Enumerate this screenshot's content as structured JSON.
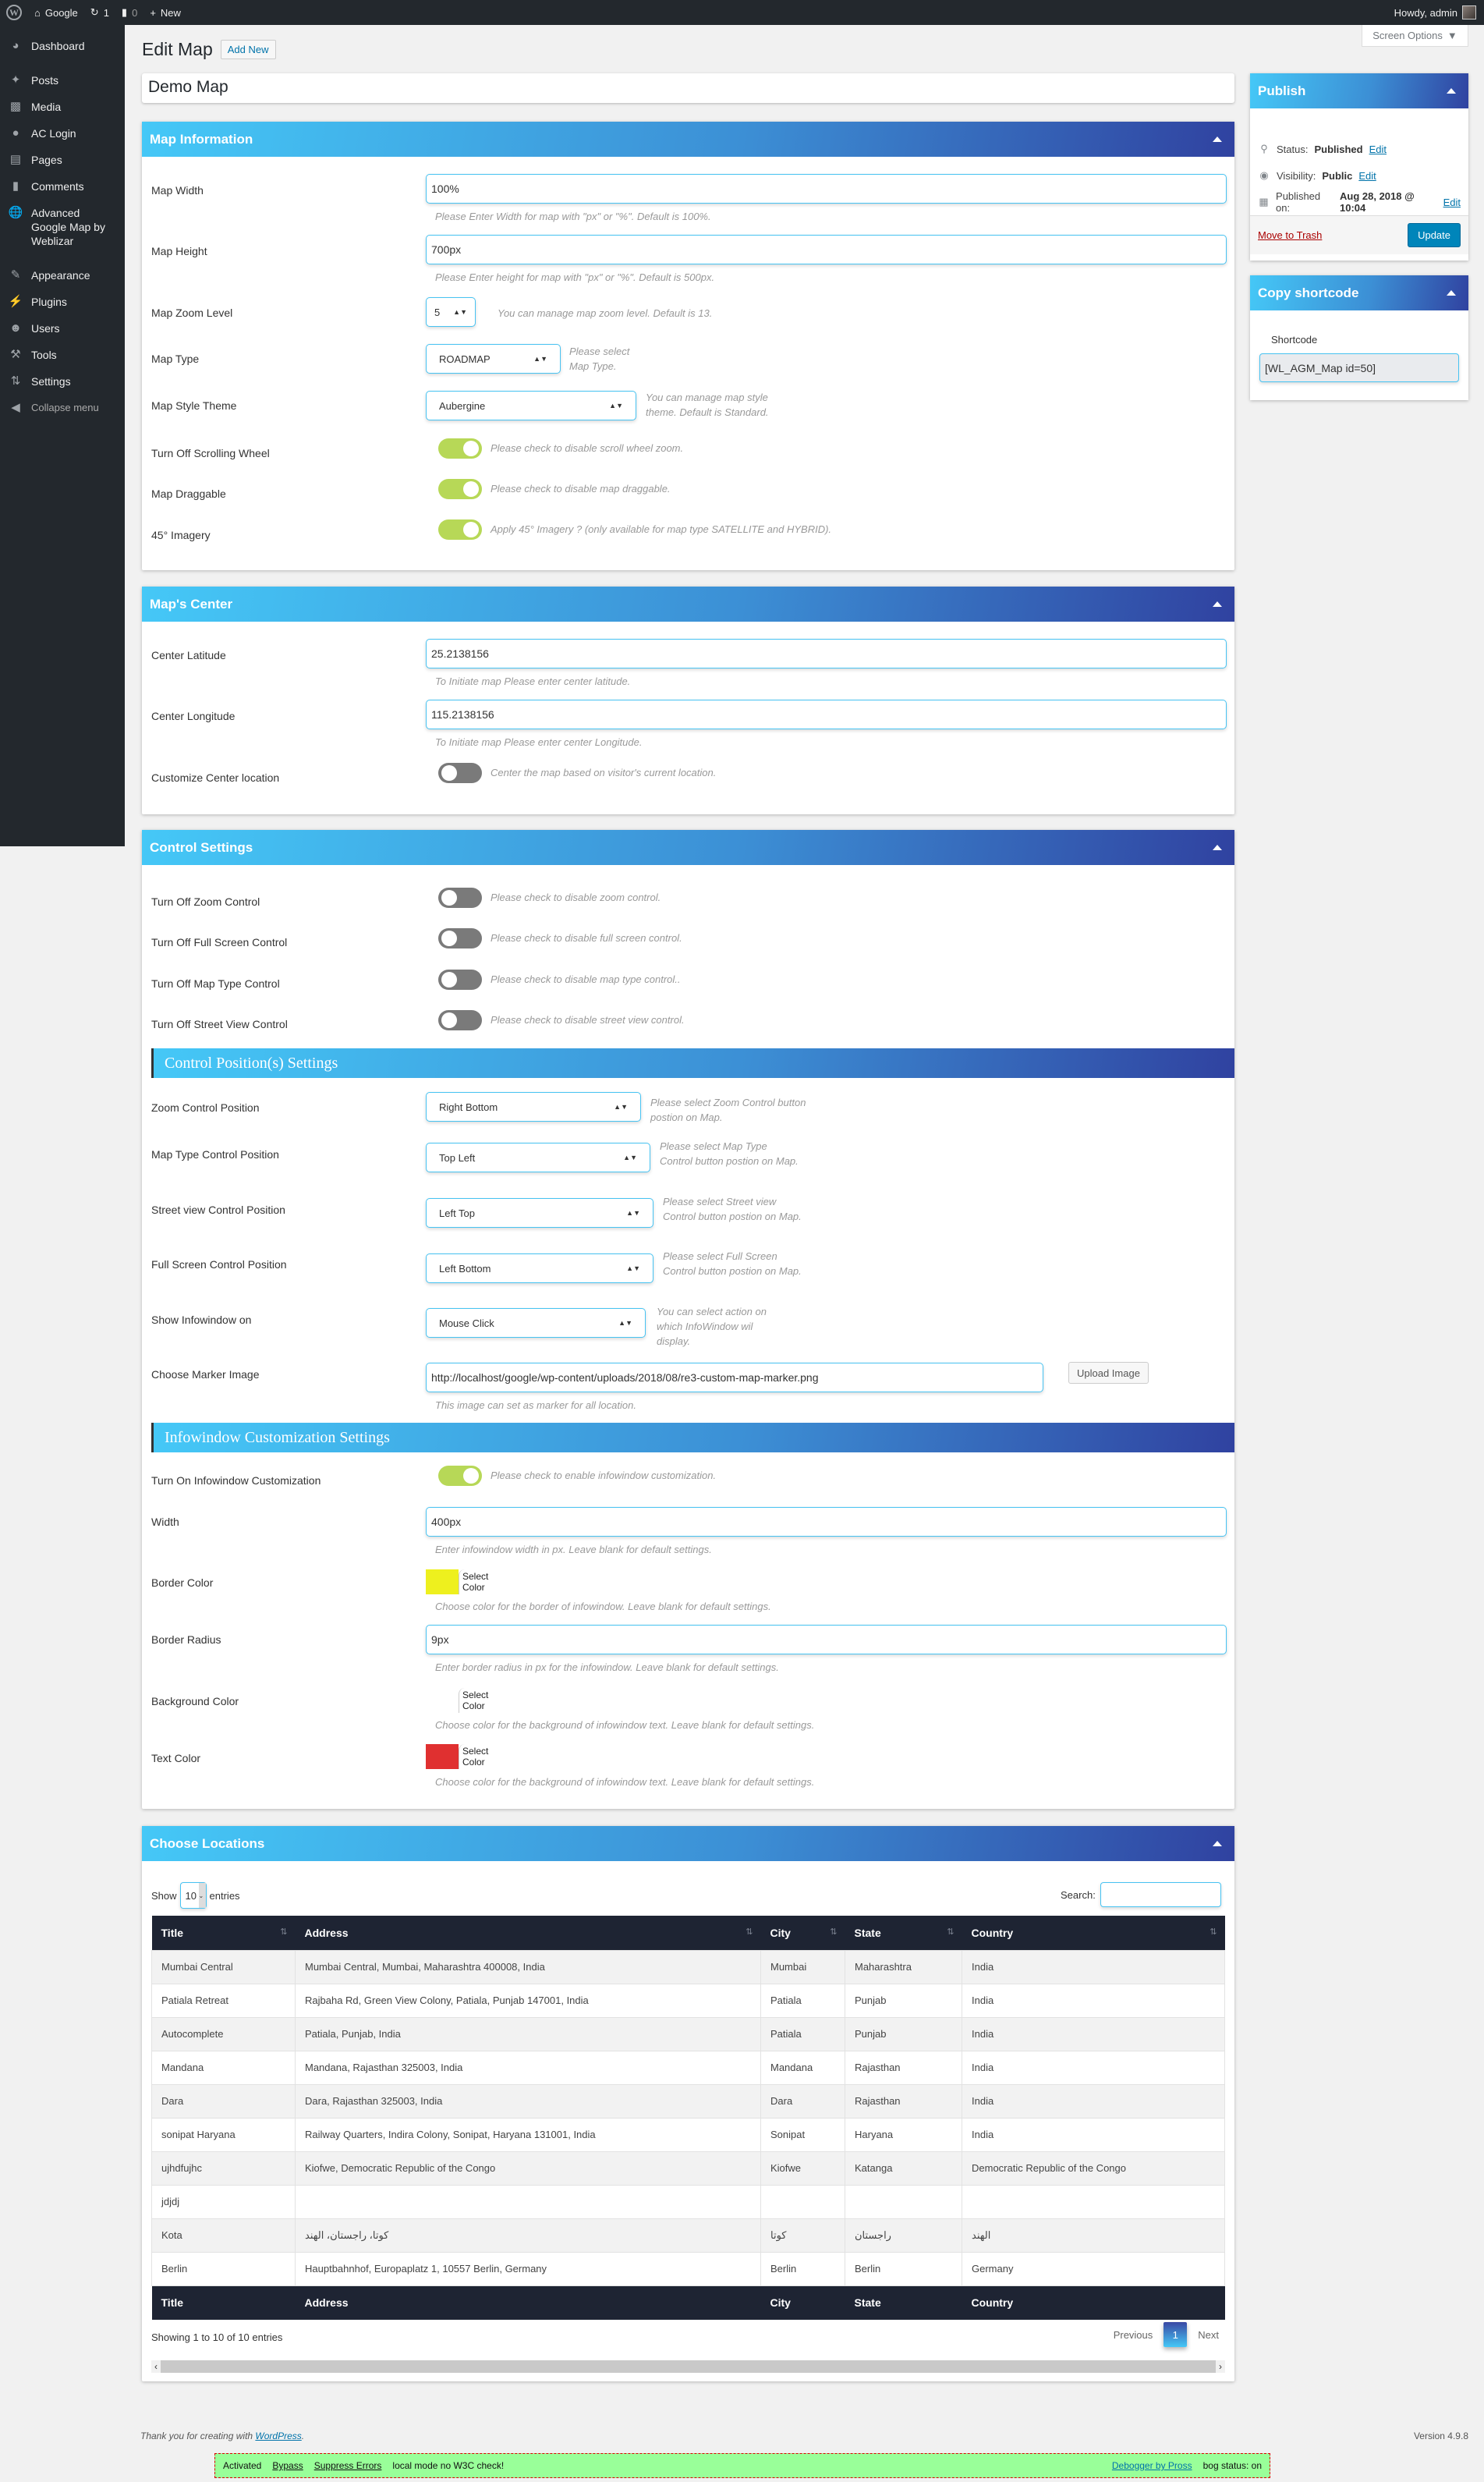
{
  "adminbar": {
    "site_name": "Google",
    "updates_count": "1",
    "comments_count": "0",
    "new_label": "New",
    "howdy": "Howdy, admin"
  },
  "sidebar": {
    "items": [
      {
        "label": "Dashboard",
        "icon": "dashboard-icon"
      },
      {
        "label": "Posts",
        "icon": "pin-icon"
      },
      {
        "label": "Media",
        "icon": "media-icon"
      },
      {
        "label": "AC Login",
        "icon": "login-icon"
      },
      {
        "label": "Pages",
        "icon": "pages-icon"
      },
      {
        "label": "Comments",
        "icon": "comment-icon"
      },
      {
        "label": "Advanced Google Map by Weblizar",
        "icon": "globe-icon"
      },
      {
        "label": "Appearance",
        "icon": "brush-icon"
      },
      {
        "label": "Plugins",
        "icon": "plug-icon"
      },
      {
        "label": "Users",
        "icon": "user-icon"
      },
      {
        "label": "Tools",
        "icon": "wrench-icon"
      },
      {
        "label": "Settings",
        "icon": "settings-icon"
      },
      {
        "label": "Collapse menu",
        "icon": "collapse-icon"
      }
    ]
  },
  "header": {
    "screen_options": "Screen Options",
    "page_title": "Edit Map",
    "add_new": "Add New",
    "post_title": "Demo Map"
  },
  "map_info": {
    "title": "Map Information",
    "width_label": "Map Width",
    "width_value": "100%",
    "width_help": "Please Enter Width for map with \"px\" or \"%\". Default is 100%.",
    "height_label": "Map Height",
    "height_value": "700px",
    "height_help": "Please Enter height for map with \"px\" or \"%\". Default is 500px.",
    "zoom_label": "Map Zoom Level",
    "zoom_value": "5",
    "zoom_help": "You can manage map zoom level. Default is 13.",
    "type_label": "Map Type",
    "type_value": "ROADMAP",
    "type_help": "Please select Map Type.",
    "style_label": "Map Style Theme",
    "style_value": "Aubergine",
    "style_help": "You can manage map style theme. Default is Standard.",
    "scroll_label": "Turn Off Scrolling Wheel",
    "scroll_on": true,
    "scroll_help": "Please check to disable scroll wheel zoom.",
    "drag_label": "Map Draggable",
    "drag_on": true,
    "drag_help": "Please check to disable map draggable.",
    "imagery_label": "45° Imagery",
    "imagery_on": true,
    "imagery_help": "Apply 45° Imagery ? (only available for map type SATELLITE and HYBRID)."
  },
  "map_center": {
    "title": "Map's Center",
    "lat_label": "Center Latitude",
    "lat_value": "25.2138156",
    "lat_help": "To Initiate map Please enter center latitude.",
    "lng_label": "Center Longitude",
    "lng_value": "115.2138156",
    "lng_help": "To Initiate map Please enter center Longitude.",
    "custom_label": "Customize Center location",
    "custom_on": false,
    "custom_help": "Center the map based on visitor's current location."
  },
  "control": {
    "title": "Control Settings",
    "zoom_ctrl_label": "Turn Off Zoom Control",
    "zoom_ctrl_help": "Please check to disable zoom control.",
    "fullscreen_label": "Turn Off Full Screen Control",
    "fullscreen_help": "Please check to disable full screen control.",
    "maptype_label": "Turn Off Map Type Control",
    "maptype_help": "Please check to disable map type control..",
    "street_label": "Turn Off Street View Control",
    "street_help": "Please check to disable street view control.",
    "positions_title": "Control Position(s) Settings",
    "zoom_pos_label": "Zoom Control Position",
    "zoom_pos_value": "Right Bottom",
    "zoom_pos_help": "Please select Zoom Control button postion on Map.",
    "maptype_pos_label": "Map Type Control Position",
    "maptype_pos_value": "Top Left",
    "maptype_pos_help": "Please select Map Type Control button postion on Map.",
    "street_pos_label": "Street view Control Position",
    "street_pos_value": "Left Top",
    "street_pos_help": "Please select Street view Control button postion on Map.",
    "fs_pos_label": "Full Screen Control Position",
    "fs_pos_value": "Left Bottom",
    "fs_pos_help": "Please select Full Screen Control button postion on Map.",
    "infowin_label": "Show Infowindow on",
    "infowin_value": "Mouse Click",
    "infowin_help": "You can select action on which InfoWindow wil display.",
    "marker_label": "Choose Marker Image",
    "marker_value": "http://localhost/google/wp-content/uploads/2018/08/re3-custom-map-marker.png",
    "marker_help": "This image can set as marker for all location.",
    "upload_label": "Upload Image",
    "infowin_title": "Infowindow Customization Settings",
    "iw_on_label": "Turn On Infowindow Customization",
    "iw_on_help": "Please check to enable infowindow customization.",
    "iw_width_label": "Width",
    "iw_width_value": "400px",
    "iw_width_help": "Enter infowindow width in px. Leave blank for default settings.",
    "border_color_label": "Border Color",
    "border_color": "#eef01e",
    "border_color_help": "Choose color for the border of infowindow. Leave blank for default settings.",
    "radius_label": "Border Radius",
    "radius_value": "9px",
    "radius_help": "Enter border radius in px for the infowindow. Leave blank for default settings.",
    "bg_color_label": "Background Color",
    "bg_color": "#ffffff",
    "bg_color_help": "Choose color for the background of infowindow text. Leave blank for default settings.",
    "text_color_label": "Text Color",
    "text_color": "#e03030",
    "text_color_help": "Choose color for the background of infowindow text. Leave blank for default settings.",
    "select_color": "Select Color"
  },
  "locations": {
    "title": "Choose Locations",
    "show": "Show",
    "entries_value": "10",
    "entries": "entries",
    "search_label": "Search:",
    "search_value": "",
    "columns": [
      "Title",
      "Address",
      "City",
      "State",
      "Country"
    ],
    "rows": [
      [
        "Mumbai Central",
        "Mumbai Central, Mumbai, Maharashtra 400008, India",
        "Mumbai",
        "Maharashtra",
        "India"
      ],
      [
        "Patiala Retreat",
        "Rajbaha Rd, Green View Colony, Patiala, Punjab 147001, India",
        "Patiala",
        "Punjab",
        "India"
      ],
      [
        "Autocomplete",
        "Patiala, Punjab, India",
        "Patiala",
        "Punjab",
        "India"
      ],
      [
        "Mandana",
        "Mandana, Rajasthan 325003, India",
        "Mandana",
        "Rajasthan",
        "India"
      ],
      [
        "Dara",
        "Dara, Rajasthan 325003, India",
        "Dara",
        "Rajasthan",
        "India"
      ],
      [
        "sonipat Haryana",
        "Railway Quarters, Indira Colony, Sonipat, Haryana 131001, India",
        "Sonipat",
        "Haryana",
        "India"
      ],
      [
        "ujhdfujhc",
        "Kiofwe, Democratic Republic of the Congo",
        "Kiofwe",
        "Katanga",
        "Democratic Republic of the Congo"
      ],
      [
        "jdjdj",
        "",
        "",
        "",
        ""
      ],
      [
        "Kota",
        "كوتا، راجستان، الهند",
        "كوتا",
        "راجستان",
        "الهند"
      ],
      [
        "Berlin",
        "Hauptbahnhof, Europaplatz 1, 10557 Berlin, Germany",
        "Berlin",
        "Berlin",
        "Germany"
      ]
    ],
    "info": "Showing 1 to 10 of 10 entries",
    "previous": "Previous",
    "page": "1",
    "next": "Next"
  },
  "publish": {
    "title": "Publish",
    "status_label": "Status:",
    "status_value": "Published",
    "visibility_label": "Visibility:",
    "visibility_value": "Public",
    "published_label": "Published on:",
    "published_value": "Aug 28, 2018 @ 10:04",
    "edit": "Edit",
    "trash": "Move to Trash",
    "update": "Update"
  },
  "shortcode": {
    "title": "Copy shortcode",
    "label": "Shortcode",
    "value": "[WL_AGM_Map id=50]"
  },
  "footer": {
    "thanks": "Thank you for creating with ",
    "wordpress": "WordPress",
    "version": "Version 4.9.8"
  },
  "debug": {
    "activated": "Activated",
    "bypass": "Bypass",
    "suppress": "Suppress Errors",
    "mode": "local mode no W3C check!",
    "by": "Debogger by Pross",
    "status": "bog status: on"
  }
}
